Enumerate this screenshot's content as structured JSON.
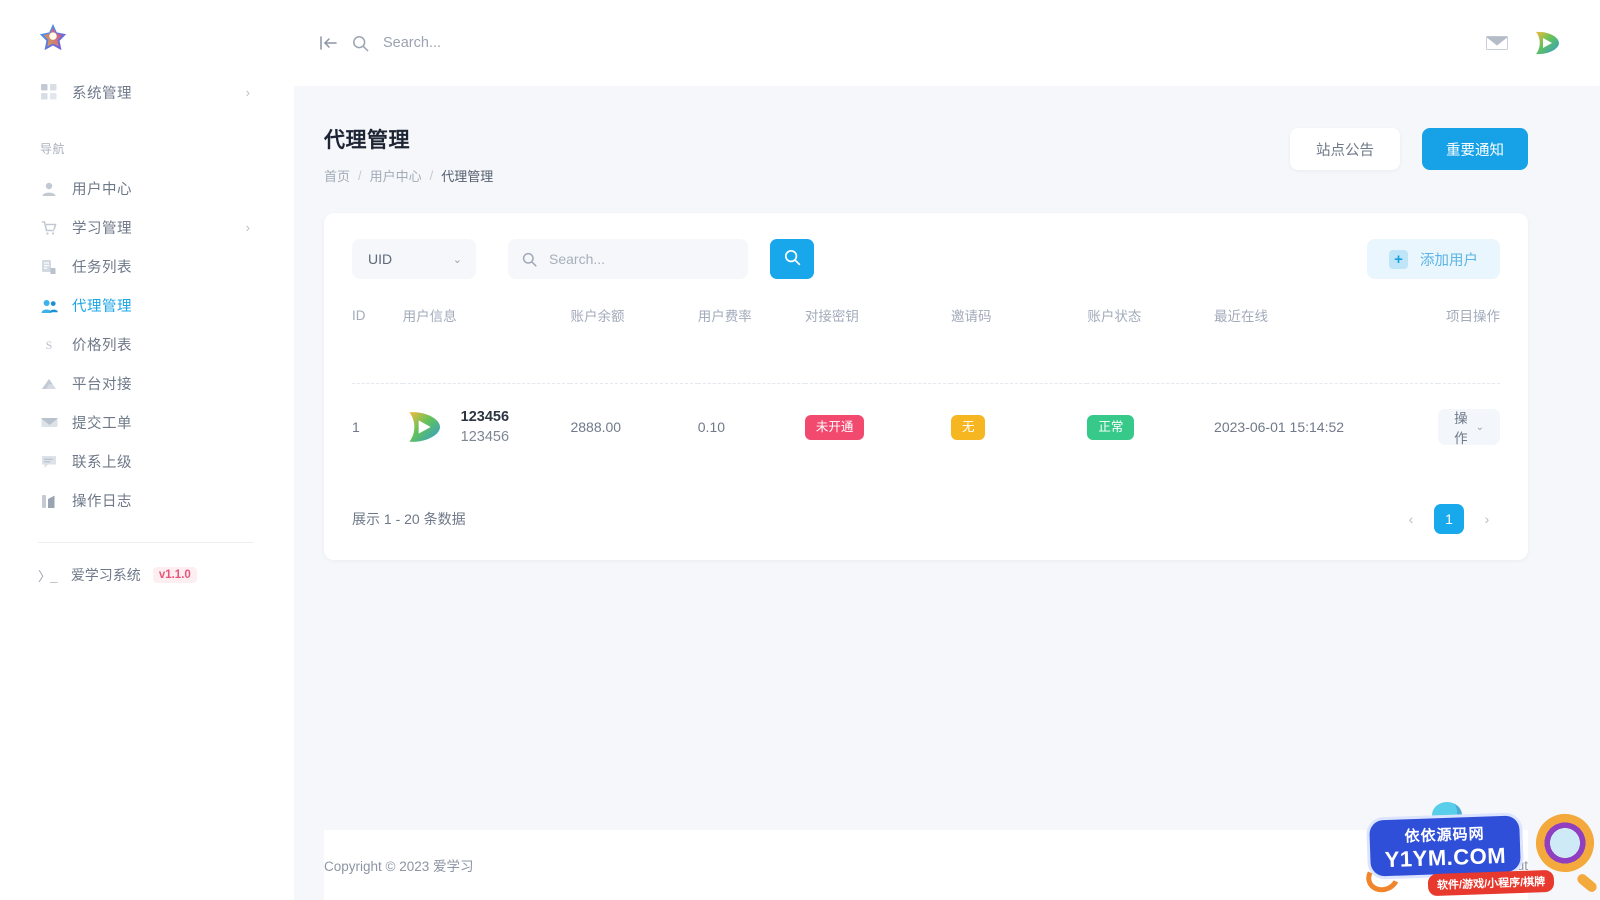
{
  "app": {
    "logo_name": "star-logo",
    "system_name": "爱学习系统",
    "version": "v1.1.0",
    "footer_prompt": "〉_"
  },
  "sidebar": {
    "system_section": {
      "label": "系统管理",
      "icon": "grid-icon",
      "chevron": "›"
    },
    "nav_heading": "导航",
    "items": [
      {
        "label": "用户中心",
        "icon": "user-icon",
        "active": false,
        "chevron": ""
      },
      {
        "label": "学习管理",
        "icon": "cart-icon",
        "active": false,
        "chevron": "›"
      },
      {
        "label": "任务列表",
        "icon": "task-list-icon",
        "active": false,
        "chevron": ""
      },
      {
        "label": "代理管理",
        "icon": "agents-icon",
        "active": true,
        "chevron": ""
      },
      {
        "label": "价格列表",
        "icon": "dollar-s-icon",
        "active": false,
        "chevron": ""
      },
      {
        "label": "平台对接",
        "icon": "triangle-cloud-icon",
        "active": false,
        "chevron": ""
      },
      {
        "label": "提交工单",
        "icon": "envelope-icon",
        "active": false,
        "chevron": ""
      },
      {
        "label": "联系上级",
        "icon": "chat-lines-icon",
        "active": false,
        "chevron": ""
      },
      {
        "label": "操作日志",
        "icon": "bar-chart-icon",
        "active": false,
        "chevron": ""
      }
    ]
  },
  "topbar": {
    "collapse_icon": "collapse-left-icon",
    "search_icon": "search-icon",
    "search_placeholder": "Search...",
    "search_value": "",
    "mail_icon": "mail-icon",
    "avatar_icon": "tencent-video-avatar"
  },
  "page": {
    "title": "代理管理",
    "breadcrumb": [
      {
        "label": "首页",
        "current": false
      },
      {
        "label": "用户中心",
        "current": false
      },
      {
        "label": "代理管理",
        "current": true
      }
    ],
    "separator": "/",
    "actions": {
      "secondary_label": "站点公告",
      "primary_label": "重要通知"
    }
  },
  "toolbar": {
    "select_value": "UID",
    "select_caret": "⌄",
    "search_placeholder": "Search...",
    "search_value": "",
    "search_button_icon": "search-icon",
    "add_user_label": "添加用户",
    "add_user_plus": "+"
  },
  "table": {
    "columns": [
      "ID",
      "用户信息",
      "账户余额",
      "用户费率",
      "对接密钥",
      "邀请码",
      "账户状态",
      "最近在线",
      "项目操作"
    ],
    "rows": [
      {
        "id": "1",
        "avatar_icon": "tencent-video-avatar",
        "user_name": "123456",
        "user_sub": "123456",
        "balance": "2888.00",
        "rate": "0.10",
        "secret_badge": {
          "text": "未开通",
          "color": "#f24a6f",
          "tone": "pink"
        },
        "invite_badge": {
          "text": "无",
          "color": "#f5b621",
          "tone": "amber"
        },
        "status_badge": {
          "text": "正常",
          "color": "#37c98a",
          "tone": "green"
        },
        "last_online": "2023-06-01 15:14:52",
        "action_label": "操作",
        "action_caret": "⌄"
      }
    ]
  },
  "pagination": {
    "summary": "展示 1 - 20 条数据",
    "prev_icon": "‹",
    "next_icon": "›",
    "current_page": "1"
  },
  "footer": {
    "copyright": "Copyright © 2023 爱学习",
    "about": "About"
  },
  "watermark": {
    "line1": "依依源码网",
    "line2": "Y1YM.COM",
    "tagline": "软件/游戏/小程序/棋牌"
  },
  "colors": {
    "accent": "#17a2e8",
    "badge_pink": "#f24a6f",
    "badge_amber": "#f5b621",
    "badge_green": "#37c98a",
    "version_badge": "#e8557a",
    "page_bg": "#f5f7fa"
  }
}
